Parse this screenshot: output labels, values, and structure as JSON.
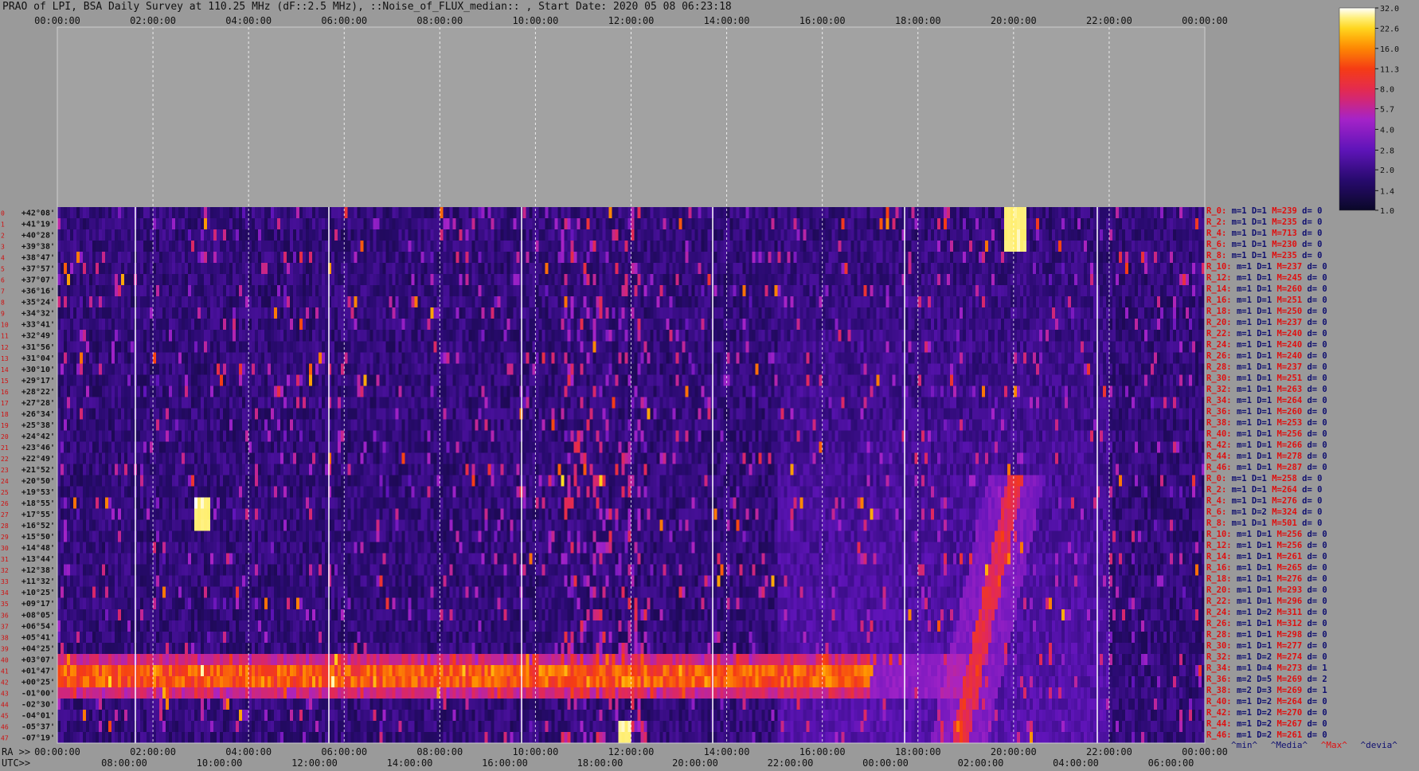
{
  "title": "PRAO of LPI, BSA Daily Survey at 110.25 MHz (dF::2.5 MHz), ::Noise_of_FLUX_median:: , Start Date: 2020 05 08 06:23:18",
  "chart_data": {
    "type": "heatmap",
    "title": "PRAO of LPI, BSA Daily Survey at 110.25 MHz (dF::2.5 MHz), ::Noise_of_FLUX_median:: , Start Date: 2020 05 08 06:23:18",
    "top_ticks": [
      "00:00:00",
      "02:00:00",
      "04:00:00",
      "06:00:00",
      "08:00:00",
      "10:00:00",
      "12:00:00",
      "14:00:00",
      "16:00:00",
      "18:00:00",
      "20:00:00",
      "22:00:00",
      "00:00:00"
    ],
    "ra_label": "RA >>",
    "ra_ticks": [
      "00:00:00",
      "02:00:00",
      "04:00:00",
      "06:00:00",
      "08:00:00",
      "10:00:00",
      "12:00:00",
      "14:00:00",
      "16:00:00",
      "18:00:00",
      "20:00:00",
      "22:00:00",
      "00:00:00"
    ],
    "utc_label": "UTC>>",
    "utc_ticks": [
      "08:00:00",
      "10:00:00",
      "12:00:00",
      "14:00:00",
      "16:00:00",
      "18:00:00",
      "20:00:00",
      "22:00:00",
      "00:00:00",
      "02:00:00",
      "04:00:00",
      "06:00:00"
    ],
    "declinations": [
      "+42°08'",
      "+41°19'",
      "+40°28'",
      "+39°38'",
      "+38°47'",
      "+37°57'",
      "+37°07'",
      "+36°16'",
      "+35°24'",
      "+34°32'",
      "+33°41'",
      "+32°49'",
      "+31°56'",
      "+31°04'",
      "+30°10'",
      "+29°17'",
      "+28°22'",
      "+27°28'",
      "+26°34'",
      "+25°38'",
      "+24°42'",
      "+23°46'",
      "+22°49'",
      "+21°52'",
      "+20°50'",
      "+19°53'",
      "+18°55'",
      "+17°55'",
      "+16°52'",
      "+15°50'",
      "+14°48'",
      "+13°44'",
      "+12°38'",
      "+11°32'",
      "+10°25'",
      "+09°17'",
      "+08°05'",
      "+06°54'",
      "+05°41'",
      "+04°25'",
      "+03°07'",
      "+01°47'",
      "+00°25'",
      "-01°00'",
      "-02°30'",
      "-04°01'",
      "-05°37'",
      "-07°19'"
    ],
    "colorbar": {
      "ticks": [
        "32.0",
        "22.6",
        "16.0",
        "11.3",
        "8.0",
        "5.7",
        "4.0",
        "2.8",
        "2.0",
        "1.4",
        "1.0"
      ],
      "min": 1.0,
      "max": 32.0,
      "scale": "log"
    },
    "features": {
      "horizontal_band": {
        "dec_from": "+03°07'",
        "dec_to": "-01°00'",
        "ra_from": "00:00",
        "ra_to": "17:00"
      },
      "diagonal_arc_dec_range": [
        "+20°50'",
        "-07°19'"
      ],
      "bright_sources": [
        {
          "ra": "03:00",
          "dec": "+17°55'"
        },
        {
          "ra": "20:00",
          "dec": "+41°00'"
        },
        {
          "ra": "11:50",
          "dec": "-07°19'"
        }
      ]
    },
    "stats": [
      {
        "r": "R_0:",
        "m": "m=1",
        "d": "D=1",
        "x": "M=239",
        "v": "d= 0"
      },
      {
        "r": "R_2:",
        "m": "m=1",
        "d": "D=1",
        "x": "M=235",
        "v": "d= 0"
      },
      {
        "r": "R_4:",
        "m": "m=1",
        "d": "D=1",
        "x": "M=713",
        "v": "d= 0"
      },
      {
        "r": "R_6:",
        "m": "m=1",
        "d": "D=1",
        "x": "M=230",
        "v": "d= 0"
      },
      {
        "r": "R_8:",
        "m": "m=1",
        "d": "D=1",
        "x": "M=235",
        "v": "d= 0"
      },
      {
        "r": "R_10:",
        "m": "m=1",
        "d": "D=1",
        "x": "M=237",
        "v": "d= 0"
      },
      {
        "r": "R_12:",
        "m": "m=1",
        "d": "D=1",
        "x": "M=245",
        "v": "d= 0"
      },
      {
        "r": "R_14:",
        "m": "m=1",
        "d": "D=1",
        "x": "M=260",
        "v": "d= 0"
      },
      {
        "r": "R_16:",
        "m": "m=1",
        "d": "D=1",
        "x": "M=251",
        "v": "d= 0"
      },
      {
        "r": "R_18:",
        "m": "m=1",
        "d": "D=1",
        "x": "M=250",
        "v": "d= 0"
      },
      {
        "r": "R_20:",
        "m": "m=1",
        "d": "D=1",
        "x": "M=237",
        "v": "d= 0"
      },
      {
        "r": "R_22:",
        "m": "m=1",
        "d": "D=1",
        "x": "M=240",
        "v": "d= 0"
      },
      {
        "r": "R_24:",
        "m": "m=1",
        "d": "D=1",
        "x": "M=240",
        "v": "d= 0"
      },
      {
        "r": "R_26:",
        "m": "m=1",
        "d": "D=1",
        "x": "M=240",
        "v": "d= 0"
      },
      {
        "r": "R_28:",
        "m": "m=1",
        "d": "D=1",
        "x": "M=237",
        "v": "d= 0"
      },
      {
        "r": "R_30:",
        "m": "m=1",
        "d": "D=1",
        "x": "M=251",
        "v": "d= 0"
      },
      {
        "r": "R_32:",
        "m": "m=1",
        "d": "D=1",
        "x": "M=263",
        "v": "d= 0"
      },
      {
        "r": "R_34:",
        "m": "m=1",
        "d": "D=1",
        "x": "M=264",
        "v": "d= 0"
      },
      {
        "r": "R_36:",
        "m": "m=1",
        "d": "D=1",
        "x": "M=260",
        "v": "d= 0"
      },
      {
        "r": "R_38:",
        "m": "m=1",
        "d": "D=1",
        "x": "M=253",
        "v": "d= 0"
      },
      {
        "r": "R_40:",
        "m": "m=1",
        "d": "D=1",
        "x": "M=256",
        "v": "d= 0"
      },
      {
        "r": "R_42:",
        "m": "m=1",
        "d": "D=1",
        "x": "M=266",
        "v": "d= 0"
      },
      {
        "r": "R_44:",
        "m": "m=1",
        "d": "D=1",
        "x": "M=278",
        "v": "d= 0"
      },
      {
        "r": "R_46:",
        "m": "m=1",
        "d": "D=1",
        "x": "M=287",
        "v": "d= 0"
      },
      {
        "r": "R_0:",
        "m": "m=1",
        "d": "D=1",
        "x": "M=258",
        "v": "d= 0"
      },
      {
        "r": "R_2:",
        "m": "m=1",
        "d": "D=1",
        "x": "M=264",
        "v": "d= 0"
      },
      {
        "r": "R_4:",
        "m": "m=1",
        "d": "D=1",
        "x": "M=276",
        "v": "d= 0"
      },
      {
        "r": "R_6:",
        "m": "m=1",
        "d": "D=2",
        "x": "M=324",
        "v": "d= 0"
      },
      {
        "r": "R_8:",
        "m": "m=1",
        "d": "D=1",
        "x": "M=501",
        "v": "d= 0"
      },
      {
        "r": "R_10:",
        "m": "m=1",
        "d": "D=1",
        "x": "M=256",
        "v": "d= 0"
      },
      {
        "r": "R_12:",
        "m": "m=1",
        "d": "D=1",
        "x": "M=256",
        "v": "d= 0"
      },
      {
        "r": "R_14:",
        "m": "m=1",
        "d": "D=1",
        "x": "M=261",
        "v": "d= 0"
      },
      {
        "r": "R_16:",
        "m": "m=1",
        "d": "D=1",
        "x": "M=265",
        "v": "d= 0"
      },
      {
        "r": "R_18:",
        "m": "m=1",
        "d": "D=1",
        "x": "M=276",
        "v": "d= 0"
      },
      {
        "r": "R_20:",
        "m": "m=1",
        "d": "D=1",
        "x": "M=293",
        "v": "d= 0"
      },
      {
        "r": "R_22:",
        "m": "m=1",
        "d": "D=1",
        "x": "M=296",
        "v": "d= 0"
      },
      {
        "r": "R_24:",
        "m": "m=1",
        "d": "D=2",
        "x": "M=311",
        "v": "d= 0"
      },
      {
        "r": "R_26:",
        "m": "m=1",
        "d": "D=1",
        "x": "M=312",
        "v": "d= 0"
      },
      {
        "r": "R_28:",
        "m": "m=1",
        "d": "D=1",
        "x": "M=298",
        "v": "d= 0"
      },
      {
        "r": "R_30:",
        "m": "m=1",
        "d": "D=1",
        "x": "M=277",
        "v": "d= 0"
      },
      {
        "r": "R_32:",
        "m": "m=1",
        "d": "D=2",
        "x": "M=274",
        "v": "d= 0"
      },
      {
        "r": "R_34:",
        "m": "m=1",
        "d": "D=4",
        "x": "M=273",
        "v": "d= 1"
      },
      {
        "r": "R_36:",
        "m": "m=2",
        "d": "D=5",
        "x": "M=269",
        "v": "d= 2"
      },
      {
        "r": "R_38:",
        "m": "m=2",
        "d": "D=3",
        "x": "M=269",
        "v": "d= 1"
      },
      {
        "r": "R_40:",
        "m": "m=1",
        "d": "D=2",
        "x": "M=264",
        "v": "d= 0"
      },
      {
        "r": "R_42:",
        "m": "m=1",
        "d": "D=2",
        "x": "M=270",
        "v": "d= 0"
      },
      {
        "r": "R_44:",
        "m": "m=1",
        "d": "D=2",
        "x": "M=267",
        "v": "d= 0"
      },
      {
        "r": "R_46:",
        "m": "m=1",
        "d": "D=2",
        "x": "M=261",
        "v": "d= 0"
      }
    ]
  },
  "legend": {
    "min": "^min^",
    "median": "^Media^",
    "max": "^Max^",
    "dev": "^devia^",
    "colors": {
      "min": "#101070",
      "median": "#101070",
      "max": "#e01010",
      "dev": "#101070"
    }
  }
}
